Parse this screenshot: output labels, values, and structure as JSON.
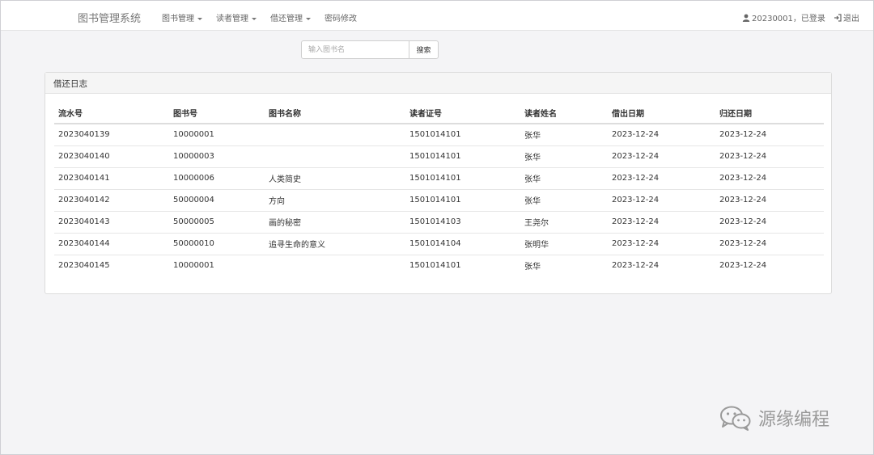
{
  "navbar": {
    "brand": "图书管理系统",
    "menu": [
      {
        "label": "图书管理",
        "dropdown": true
      },
      {
        "label": "读者管理",
        "dropdown": true
      },
      {
        "label": "借还管理",
        "dropdown": true
      },
      {
        "label": "密码修改",
        "dropdown": false
      }
    ],
    "user_status": "20230001，已登录",
    "logout": "退出"
  },
  "search": {
    "placeholder": "输入图书名",
    "button": "搜索"
  },
  "panel": {
    "title": "借还日志",
    "columns": [
      "流水号",
      "图书号",
      "图书名称",
      "读者证号",
      "读者姓名",
      "借出日期",
      "归还日期"
    ],
    "rows": [
      [
        "2023040139",
        "10000001",
        "",
        "1501014101",
        "张华",
        "2023-12-24",
        "2023-12-24"
      ],
      [
        "2023040140",
        "10000003",
        "",
        "1501014101",
        "张华",
        "2023-12-24",
        "2023-12-24"
      ],
      [
        "2023040141",
        "10000006",
        "人类简史",
        "1501014101",
        "张华",
        "2023-12-24",
        "2023-12-24"
      ],
      [
        "2023040142",
        "50000004",
        "方向",
        "1501014101",
        "张华",
        "2023-12-24",
        "2023-12-24"
      ],
      [
        "2023040143",
        "50000005",
        "画的秘密",
        "1501014103",
        "王尧尔",
        "2023-12-24",
        "2023-12-24"
      ],
      [
        "2023040144",
        "50000010",
        "追寻生命的意义",
        "1501014104",
        "张明华",
        "2023-12-24",
        "2023-12-24"
      ],
      [
        "2023040145",
        "10000001",
        "",
        "1501014101",
        "张华",
        "2023-12-24",
        "2023-12-24"
      ]
    ]
  },
  "watermark": {
    "text": "源缘编程",
    "icon": "wechat-icon"
  },
  "icons": {
    "user": "user-icon",
    "logout": "logout-icon"
  }
}
